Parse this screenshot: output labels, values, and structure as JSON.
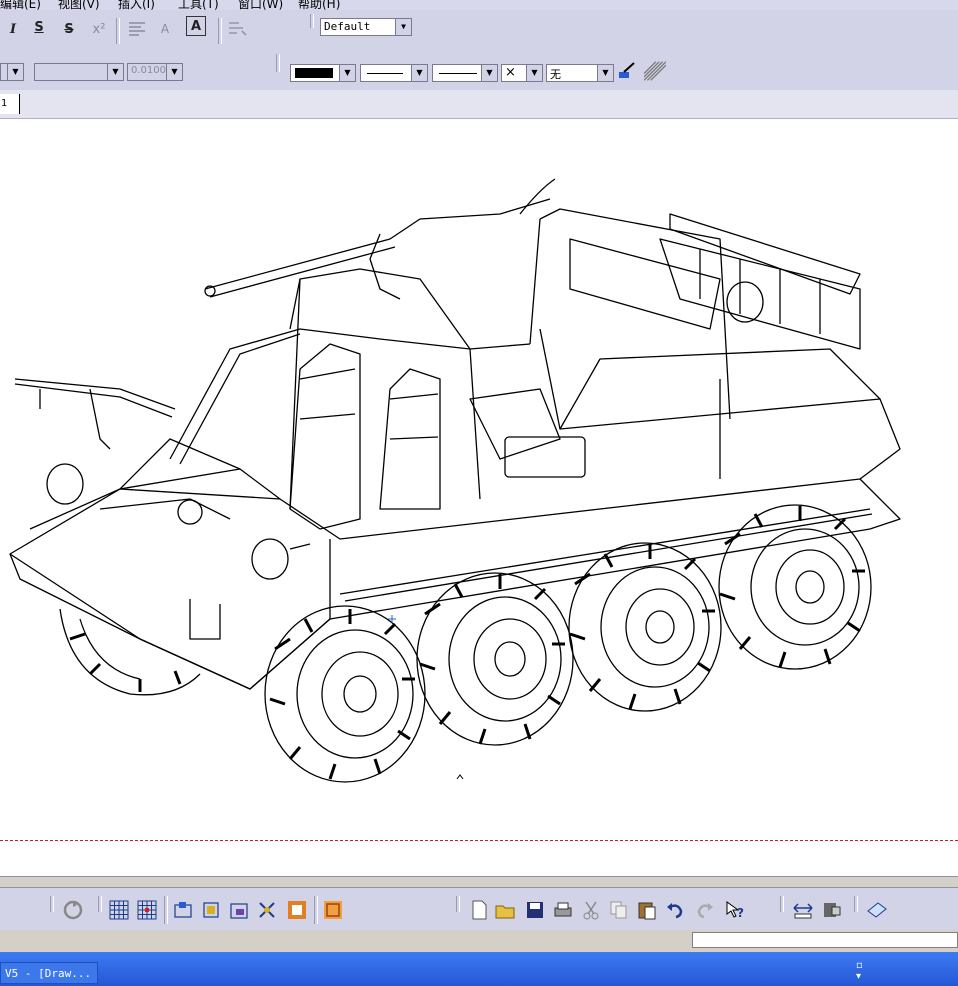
{
  "menubar": {
    "items": [
      "编辑(E)",
      "视图(V)",
      "插入(I)",
      "工具(T)",
      "窗口(W)",
      "帮助(H)"
    ]
  },
  "text_toolbar": {
    "italic": "I",
    "underline": "S",
    "strikethrough": "S",
    "superscript": "x²",
    "frame": "A",
    "style_combo": "Default"
  },
  "graphic_toolbar": {
    "scale_value": "0.0100",
    "fill_value": "无"
  },
  "tabs": [
    {
      "label": "1"
    }
  ],
  "taskbar": {
    "window_label": "V5 - [Draw..."
  },
  "colors": {
    "toolbar_bg": "#d3d3e7",
    "canvas_bg": "#ffffff",
    "sheet_border": "#c02020",
    "taskbar": "#2457d6"
  }
}
